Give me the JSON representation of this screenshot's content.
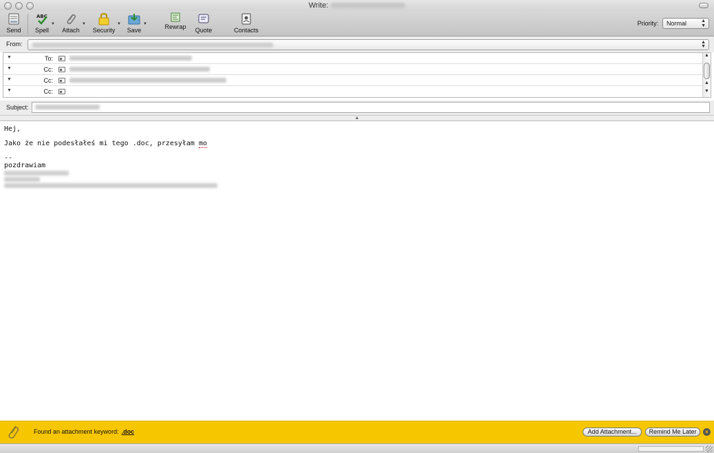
{
  "window": {
    "title_prefix": "Write:"
  },
  "toolbar": {
    "send": "Send",
    "spell": "Spell",
    "attach": "Attach",
    "security": "Security",
    "save": "Save",
    "rewrap": "Rewrap",
    "quote": "Quote",
    "contacts": "Contacts",
    "priority_label": "Priority:",
    "priority_value": "Normal"
  },
  "header": {
    "from_label": "From:",
    "recipients": [
      {
        "label": "To:"
      },
      {
        "label": "Cc:"
      },
      {
        "label": "Cc:"
      },
      {
        "label": "Cc:"
      }
    ],
    "subject_label": "Subject:"
  },
  "body": {
    "greeting": "Hej,",
    "line1_prefix": "Jako że nie podesłałeś mi tego .doc, przesyłam ",
    "line1_word": "mo",
    "sig_separator": "--",
    "sig_regards": "pozdrawiam"
  },
  "notification": {
    "text": "Found an attachment keyword:",
    "keyword": ".doc",
    "add_button": "Add Attachment...",
    "remind_button": "Remind Me Later",
    "close_symbol": "×"
  },
  "colors": {
    "notification_bg": "#f6c600",
    "toolbar_bg": "#cfcfcf"
  }
}
